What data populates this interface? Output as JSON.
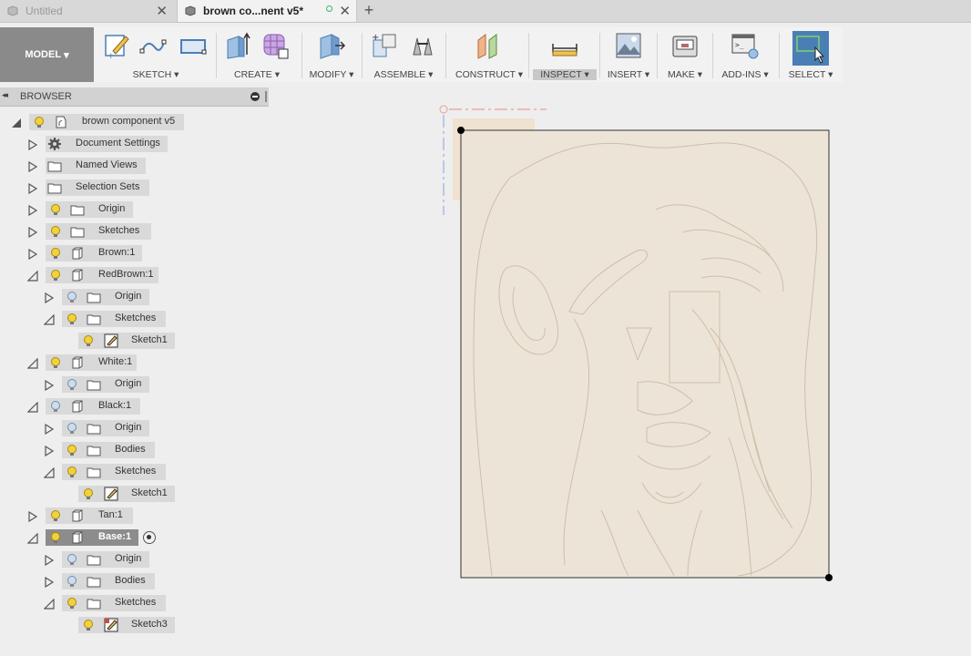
{
  "tabs": [
    {
      "title": "Untitled",
      "close": "✕",
      "active": false
    },
    {
      "title": "brown co...nent v5*",
      "close": "✕",
      "active": true
    }
  ],
  "new_tab": "+",
  "toolbar": {
    "workspace": "MODEL",
    "groups": {
      "sketch": "SKETCH",
      "create": "CREATE",
      "modify": "MODIFY",
      "assemble": "ASSEMBLE",
      "construct": "CONSTRUCT",
      "inspect": "INSPECT",
      "insert": "INSERT",
      "make": "MAKE",
      "addins": "ADD-INS",
      "select": "SELECT"
    },
    "dropdown_glyph": "▾"
  },
  "browser": {
    "title": "BROWSER",
    "collapse_glyph": "◂◂",
    "nodes": {
      "root": "brown component v5",
      "doc_settings": "Document Settings",
      "named_views": "Named Views",
      "selection_sets": "Selection Sets",
      "origin": "Origin",
      "sketches": "Sketches",
      "brown": "Brown:1",
      "redbrown": "RedBrown:1",
      "redbrown_origin": "Origin",
      "redbrown_sketches": "Sketches",
      "redbrown_sketch1": "Sketch1",
      "white": "White:1",
      "white_origin": "Origin",
      "black": "Black:1",
      "black_origin": "Origin",
      "black_bodies": "Bodies",
      "black_sketches": "Sketches",
      "black_sketch1": "Sketch1",
      "tan": "Tan:1",
      "base": "Base:1",
      "base_origin": "Origin",
      "base_bodies": "Bodies",
      "base_sketches": "Sketches",
      "base_sketch3": "Sketch3"
    }
  },
  "colors": {
    "bulb_on": "#f2d23a",
    "bulb_off": "#9fb6d6",
    "plate_fill": "#ede4d8",
    "sketch_line": "#cdbfa8",
    "accent_blue": "#4a7fb5"
  }
}
